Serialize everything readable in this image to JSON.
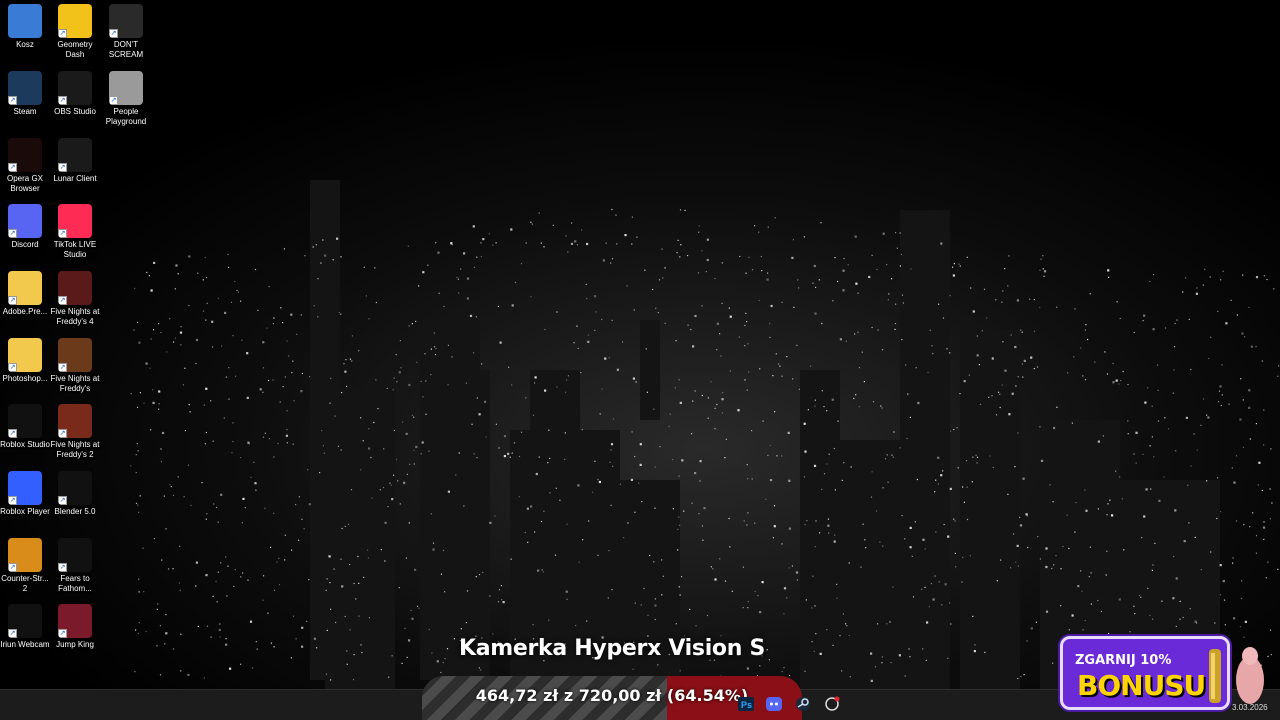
{
  "desktop": {
    "icons": [
      {
        "label": "Kosz",
        "icon": "recycle-bin-icon",
        "color": "#3a7bd5"
      },
      {
        "label": "Geometry Dash",
        "icon": "geometry-dash-icon",
        "color": "#f2c21b"
      },
      {
        "label": "DON'T SCREAM",
        "icon": "dont-scream-icon",
        "color": "#2a2a2a"
      },
      {
        "label": "Steam",
        "icon": "steam-icon",
        "color": "#1b3a5c"
      },
      {
        "label": "OBS Studio",
        "icon": "obs-icon",
        "color": "#1a1a1a"
      },
      {
        "label": "People Playground",
        "icon": "people-playground-icon",
        "color": "#9a9a9a"
      },
      {
        "label": "Opera GX Browser",
        "icon": "opera-gx-icon",
        "color": "#1a0a0a"
      },
      {
        "label": "Lunar Client",
        "icon": "lunar-client-icon",
        "color": "#1a1a1a"
      },
      {
        "label": "Discord",
        "icon": "discord-icon",
        "color": "#5865f2"
      },
      {
        "label": "TikTok LIVE Studio",
        "icon": "tiktok-live-icon",
        "color": "#fe2c55"
      },
      {
        "label": "Adobe.Pre...",
        "icon": "folder-icon",
        "color": "#f2c94c"
      },
      {
        "label": "Five Nights at Freddy's 4",
        "icon": "fnaf4-icon",
        "color": "#5a1a1a"
      },
      {
        "label": "Photoshop...",
        "icon": "folder-icon",
        "color": "#f2c94c"
      },
      {
        "label": "Five Nights at Freddy's",
        "icon": "fnaf-icon",
        "color": "#6b3a1a"
      },
      {
        "label": "Roblox Studio",
        "icon": "roblox-studio-icon",
        "color": "#111111"
      },
      {
        "label": "Five Nights at Freddy's 2",
        "icon": "fnaf2-icon",
        "color": "#7a2a1a"
      },
      {
        "label": "Roblox Player",
        "icon": "roblox-player-icon",
        "color": "#335fff"
      },
      {
        "label": "Blender 5.0",
        "icon": "blender-icon",
        "color": "#111111"
      },
      {
        "label": "Counter-Str... 2",
        "icon": "counter-strike-icon",
        "color": "#d98c1a"
      },
      {
        "label": "Fears to Fathom...",
        "icon": "fears-to-fathom-icon",
        "color": "#111111"
      },
      {
        "label": "Iriun Webcam",
        "icon": "iriun-webcam-icon",
        "color": "#111111"
      },
      {
        "label": "Jump King",
        "icon": "jump-king-icon",
        "color": "#7a1a2a"
      }
    ]
  },
  "overlay": {
    "goal_title": "Kamerka Hyperx Vision S",
    "goal_text": "464,72 zł z 720,00 zł (64.54%)",
    "goal_progress": 0.6454,
    "fill_color": "#8a0f16"
  },
  "taskbar": {
    "tray_icons": [
      "photoshop-icon",
      "discord-icon",
      "steam-icon",
      "lunar-client-icon"
    ]
  },
  "promo": {
    "line1": "ZGARNIJ 10%",
    "line2": "BONUSU"
  },
  "clock": {
    "date": "3.03.2026"
  }
}
